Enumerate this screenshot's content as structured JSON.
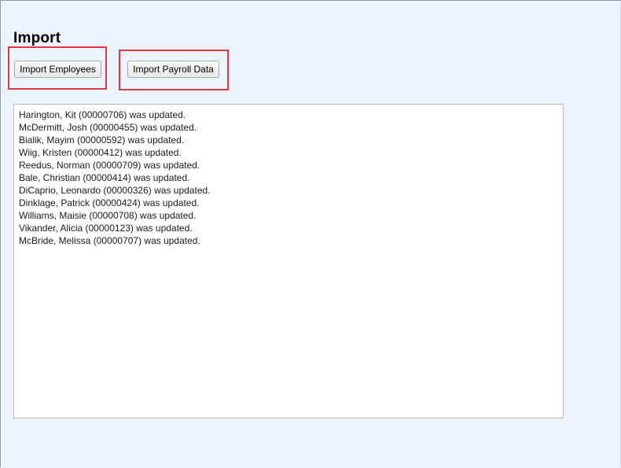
{
  "page": {
    "title": "Import"
  },
  "buttons": {
    "import_employees": "Import Employees",
    "import_payroll": "Import Payroll Data"
  },
  "log": {
    "lines": [
      "Harington, Kit (00000706) was updated.",
      "McDermitt, Josh (00000455) was updated.",
      "Bialik, Mayim (00000592) was updated.",
      "Wiig, Kristen (00000412) was updated.",
      "Reedus, Norman (00000709) was updated.",
      "Bale, Christian (00000414) was updated.",
      "DiCaprio, Leonardo (00000326) was updated.",
      "Dinklage, Patrick (00000424) was updated.",
      "Williams, Maisie (00000708) was updated.",
      "Vikander, Alicia (00000123) was updated.",
      "McBride, Melissa (00000707) was updated."
    ]
  },
  "colors": {
    "background": "#ebf3fc",
    "highlight": "#e0383e"
  }
}
